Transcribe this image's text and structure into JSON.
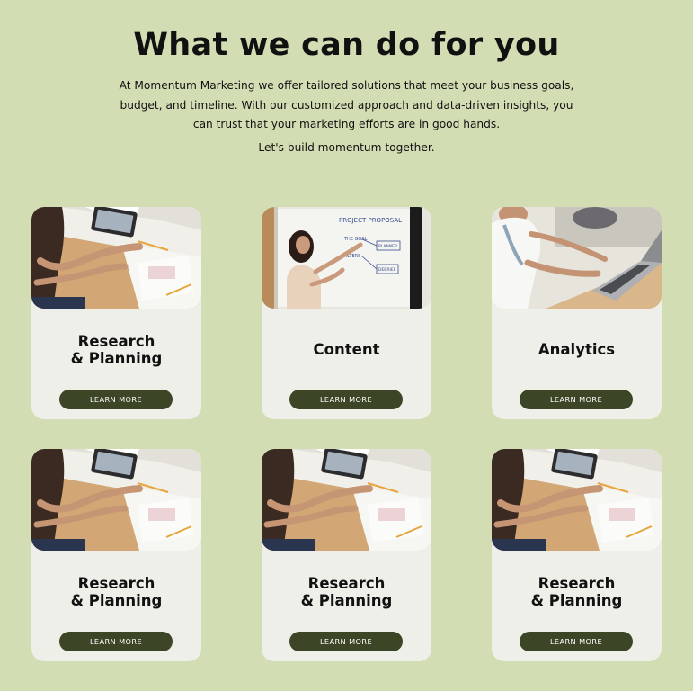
{
  "section": {
    "headline": "What we can do for you",
    "intro": "At Momentum Marketing we offer tailored solutions that meet your business goals, budget, and timeline. With our customized approach and data-driven insights, you can trust that your marketing efforts are in good hands.",
    "tagline": "Let's build momentum together."
  },
  "cards": [
    {
      "title": "Research\n& Planning",
      "button": "LEARN MORE",
      "photo": "person-with-tablet-at-desk"
    },
    {
      "title": "Content",
      "button": "LEARN MORE",
      "photo": "person-at-whiteboard"
    },
    {
      "title": "Analytics",
      "button": "LEARN MORE",
      "photo": "person-typing-on-laptop"
    },
    {
      "title": "Research\n& Planning",
      "button": "LEARN MORE",
      "photo": "person-with-tablet-at-desk"
    },
    {
      "title": "Research\n& Planning",
      "button": "LEARN MORE",
      "photo": "person-with-tablet-at-desk"
    },
    {
      "title": "Research\n& Planning",
      "button": "LEARN MORE",
      "photo": "person-with-tablet-at-desk"
    }
  ],
  "whiteboard_text": [
    "PROJECT PROPOSAL",
    "THE GOAL",
    "FILTERS",
    "PLANNER",
    "DEBRIEF"
  ],
  "colors": {
    "page_bg": "#d3ddb4",
    "card_bg": "#efefea",
    "button_bg": "#3c4526",
    "button_text": "#ffffff",
    "text": "#111111"
  }
}
